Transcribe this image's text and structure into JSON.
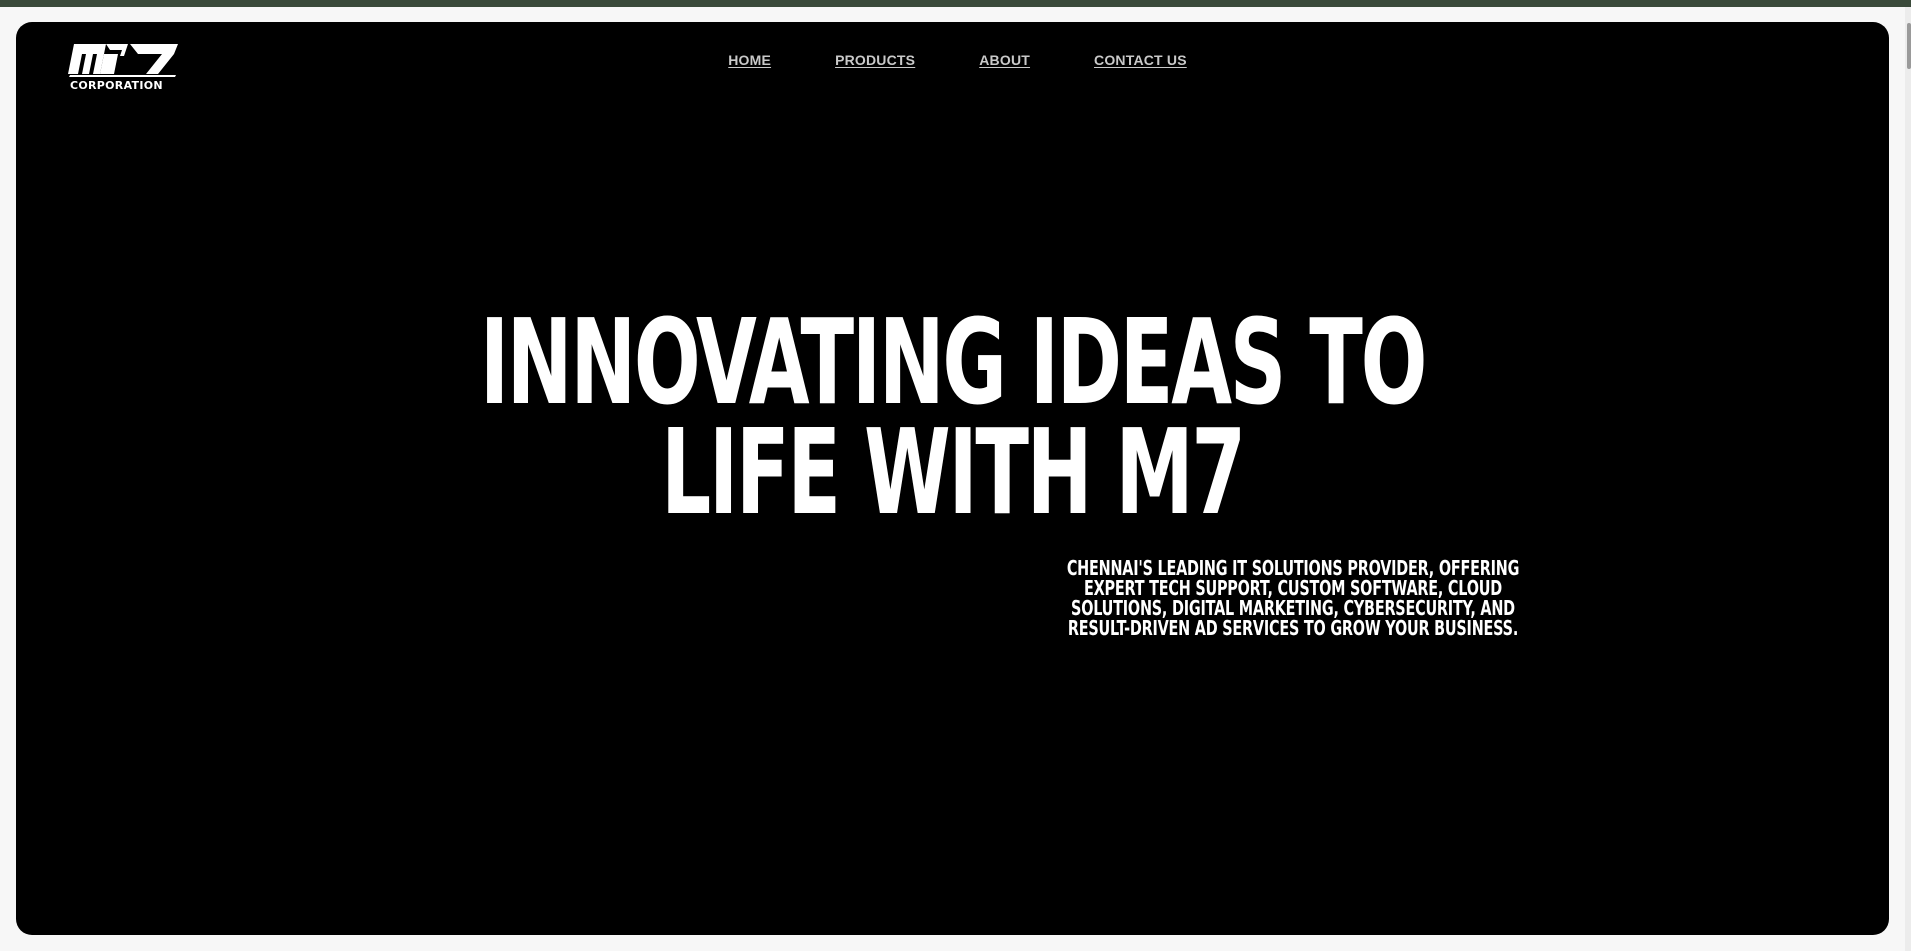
{
  "brand": {
    "logo_mark": "M7",
    "logo_subtitle": "CORPORATION"
  },
  "nav": {
    "items": [
      {
        "label": "HOME"
      },
      {
        "label": "PRODUCTS"
      },
      {
        "label": "ABOUT"
      },
      {
        "label": "CONTACT US"
      }
    ]
  },
  "hero": {
    "headline_line1": "INNOVATING IDEAS TO",
    "headline_line2": "LIFE WITH M7",
    "subtext": "CHENNAI'S LEADING IT SOLUTIONS PROVIDER, OFFERING EXPERT TECH SUPPORT, CUSTOM SOFTWARE, CLOUD SOLUTIONS, DIGITAL MARKETING, CYBERSECURITY, AND RESULT-DRIVEN AD SERVICES TO GROW YOUR BUSINESS."
  },
  "colors": {
    "hero_background": "#000000",
    "page_background": "#f7f7f7",
    "top_bar": "#3a4a3a",
    "nav_text": "#c9c9c9",
    "headline_text": "#ffffff"
  }
}
